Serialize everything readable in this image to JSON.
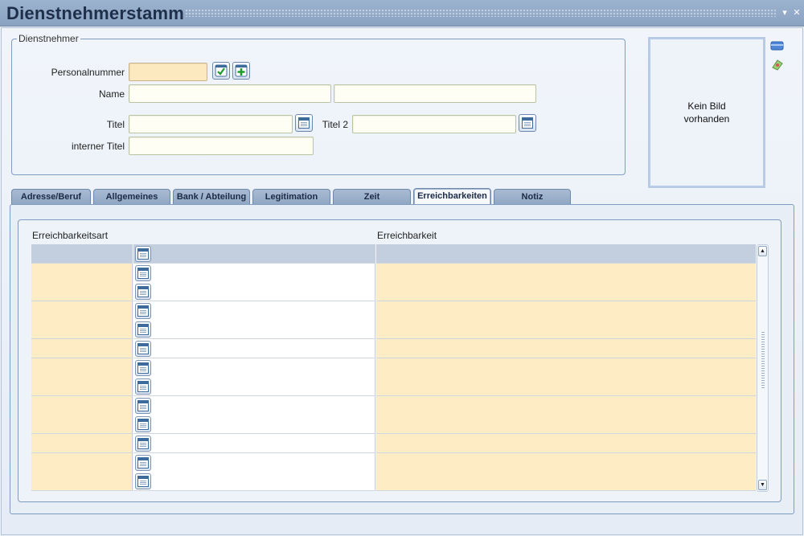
{
  "window": {
    "title": "Dienstnehmerstamm"
  },
  "group": {
    "legend": "Dienstnehmer",
    "personalnummer_label": "Personalnummer",
    "name_label": "Name",
    "titel_label": "Titel",
    "titel2_label": "Titel 2",
    "interner_titel_label": "interner Titel"
  },
  "photo": {
    "line1": "Kein Bild",
    "line2": "vorhanden"
  },
  "tabs": [
    {
      "label": "Adresse/Beruf",
      "active": false
    },
    {
      "label": "Allgemeines",
      "active": false
    },
    {
      "label": "Bank / Abteilung",
      "active": false
    },
    {
      "label": "Legitimation",
      "active": false
    },
    {
      "label": "Zeit",
      "active": false
    },
    {
      "label": "Erreichbarkeiten",
      "active": true
    },
    {
      "label": "Notiz",
      "active": false
    }
  ],
  "grid": {
    "col1_header": "Erreichbarkeitsart",
    "col2_header": "Erreichbarkeit",
    "row_count": 13
  },
  "colors": {
    "mandatory_field": "#fde9c0",
    "titlebar": "#8aa2c1",
    "accent_border": "#7f9cc2"
  },
  "icons": [
    "check-icon",
    "add-icon",
    "calendar-list-icon",
    "save-icon",
    "picture-icon",
    "minimize-icon",
    "close-icon"
  ]
}
